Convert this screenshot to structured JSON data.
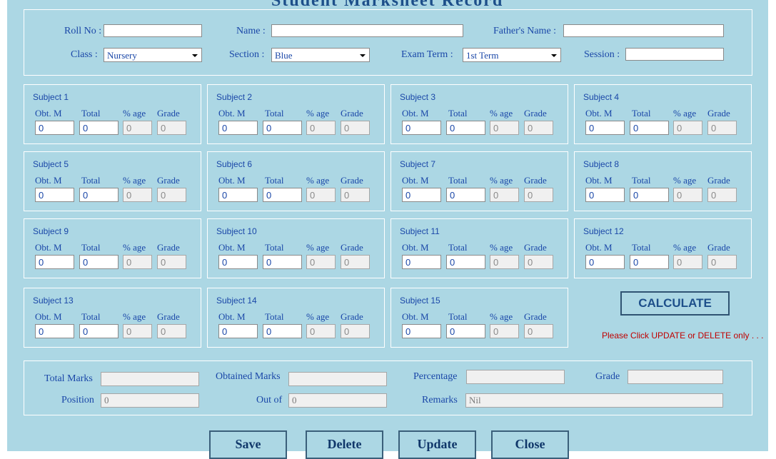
{
  "title": "Student Marksheet Record",
  "top": {
    "roll_label": "Roll No :",
    "name_label": "Name :",
    "father_label": "Father's Name :",
    "class_label": "Class :",
    "class_value": "Nursery",
    "section_label": "Section :",
    "section_value": "Blue",
    "exam_label": "Exam Term :",
    "exam_value": "1st Term",
    "session_label": "Session :"
  },
  "subject_headers": {
    "obt": "Obt. M",
    "total": "Total",
    "pct": "% age",
    "grade": "Grade"
  },
  "subjects": [
    {
      "name": "Subject 1",
      "obt": "0",
      "total": "0",
      "pct": "0",
      "grade": "0"
    },
    {
      "name": "Subject 2",
      "obt": "0",
      "total": "0",
      "pct": "0",
      "grade": "0"
    },
    {
      "name": "Subject 3",
      "obt": "0",
      "total": "0",
      "pct": "0",
      "grade": "0"
    },
    {
      "name": "Subject 4",
      "obt": "0",
      "total": "0",
      "pct": "0",
      "grade": "0"
    },
    {
      "name": "Subject 5",
      "obt": "0",
      "total": "0",
      "pct": "0",
      "grade": "0"
    },
    {
      "name": "Subject 6",
      "obt": "0",
      "total": "0",
      "pct": "0",
      "grade": "0"
    },
    {
      "name": "Subject 7",
      "obt": "0",
      "total": "0",
      "pct": "0",
      "grade": "0"
    },
    {
      "name": "Subject 8",
      "obt": "0",
      "total": "0",
      "pct": "0",
      "grade": "0"
    },
    {
      "name": "Subject 9",
      "obt": "0",
      "total": "0",
      "pct": "0",
      "grade": "0"
    },
    {
      "name": "Subject 10",
      "obt": "0",
      "total": "0",
      "pct": "0",
      "grade": "0"
    },
    {
      "name": "Subject 11",
      "obt": "0",
      "total": "0",
      "pct": "0",
      "grade": "0"
    },
    {
      "name": "Subject 12",
      "obt": "0",
      "total": "0",
      "pct": "0",
      "grade": "0"
    },
    {
      "name": "Subject 13",
      "obt": "0",
      "total": "0",
      "pct": "0",
      "grade": "0"
    },
    {
      "name": "Subject 14",
      "obt": "0",
      "total": "0",
      "pct": "0",
      "grade": "0"
    },
    {
      "name": "Subject 15",
      "obt": "0",
      "total": "0",
      "pct": "0",
      "grade": "0"
    }
  ],
  "calculate_label": "CALCULATE",
  "notice": "Please Click UPDATE or DELETE only . . .",
  "summary": {
    "total_marks_label": "Total Marks",
    "obtained_label": "Obtained Marks",
    "percentage_label": "Percentage",
    "grade_label": "Grade",
    "position_label": "Position",
    "position_value": "0",
    "outof_label": "Out of",
    "outof_value": "0",
    "remarks_label": "Remarks",
    "remarks_value": "Nil"
  },
  "buttons": {
    "save": "Save",
    "delete": "Delete",
    "update": "Update",
    "close": "Close"
  }
}
